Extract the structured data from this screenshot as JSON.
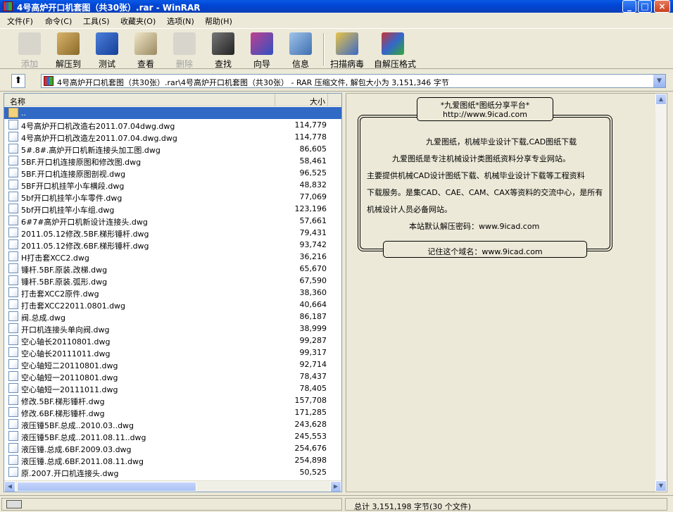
{
  "window": {
    "title": "4号高炉开口机套图（共30张）.rar - WinRAR",
    "min": "_",
    "max": "□",
    "close": "×"
  },
  "menu": [
    "文件(F)",
    "命令(C)",
    "工具(S)",
    "收藏夹(O)",
    "选项(N)",
    "帮助(H)"
  ],
  "toolbar": [
    {
      "label": "添加",
      "icon": "add-icon",
      "disabled": true
    },
    {
      "label": "解压到",
      "icon": "extract-icon",
      "disabled": false
    },
    {
      "label": "测试",
      "icon": "test-icon",
      "disabled": false
    },
    {
      "label": "查看",
      "icon": "view-icon",
      "disabled": false
    },
    {
      "label": "删除",
      "icon": "delete-icon",
      "disabled": true
    },
    {
      "label": "查找",
      "icon": "find-icon",
      "disabled": false
    },
    {
      "label": "向导",
      "icon": "wizard-icon",
      "disabled": false
    },
    {
      "label": "信息",
      "icon": "info-icon",
      "disabled": false
    },
    {
      "label": "扫描病毒",
      "icon": "virus-scan-icon",
      "disabled": false
    },
    {
      "label": "自解压格式",
      "icon": "sfx-icon",
      "disabled": false
    }
  ],
  "address": "4号高炉开口机套图（共30张）.rar\\4号高炉开口机套图（共30张） - RAR 压缩文件, 解包大小为 3,151,346 字节",
  "columns": {
    "name": "名称",
    "size": "大小"
  },
  "files": [
    {
      "name": "..",
      "size": "",
      "folder": true
    },
    {
      "name": "4号高炉开口机改造右2011.07.04dwg.dwg",
      "size": "114,779"
    },
    {
      "name": "4号高炉开口机改造左2011.07.04.dwg.dwg",
      "size": "114,778"
    },
    {
      "name": "5#.8#.高炉开口机新连接头加工图.dwg",
      "size": "86,605"
    },
    {
      "name": "5BF.开口机连接原图和修改图.dwg",
      "size": "58,461"
    },
    {
      "name": "5BF.开口机连接原图剖视.dwg",
      "size": "96,525"
    },
    {
      "name": "5BF开口机挂竿小车横段.dwg",
      "size": "48,832"
    },
    {
      "name": "5bf开口机挂竿小车零件.dwg",
      "size": "77,069"
    },
    {
      "name": "5bf开口机挂竿小车组.dwg",
      "size": "123,196"
    },
    {
      "name": "6#7#高炉开口机新设计连接头.dwg",
      "size": "57,661"
    },
    {
      "name": "2011.05.12修改.5BF.梯形锤杆.dwg",
      "size": "79,431"
    },
    {
      "name": "2011.05.12修改.6BF.梯形锤杆.dwg",
      "size": "93,742"
    },
    {
      "name": "H打击套XCC2.dwg",
      "size": "36,216"
    },
    {
      "name": "锤杆.5BF.原装.改梯.dwg",
      "size": "65,670"
    },
    {
      "name": "锤杆.5BF.原装.弧形.dwg",
      "size": "67,590"
    },
    {
      "name": "打击套XCC2原件.dwg",
      "size": "38,360"
    },
    {
      "name": "打击套XCC22011.0801.dwg",
      "size": "40,664"
    },
    {
      "name": "阀.总成.dwg",
      "size": "86,187"
    },
    {
      "name": "开口机连接头单向阀.dwg",
      "size": "38,999"
    },
    {
      "name": "空心轴长20110801.dwg",
      "size": "99,287"
    },
    {
      "name": "空心轴长20111011.dwg",
      "size": "99,317"
    },
    {
      "name": "空心轴短二20110801.dwg",
      "size": "92,714"
    },
    {
      "name": "空心轴短一20110801.dwg",
      "size": "78,437"
    },
    {
      "name": "空心轴短一20111011.dwg",
      "size": "78,405"
    },
    {
      "name": "修改.5BF.梯形锤杆.dwg",
      "size": "157,708"
    },
    {
      "name": "修改.6BF.梯形锤杆.dwg",
      "size": "171,285"
    },
    {
      "name": "液压锤5BF.总成..2010.03..dwg",
      "size": "243,628"
    },
    {
      "name": "液压锤5BF.总成..2011.08.11..dwg",
      "size": "245,553"
    },
    {
      "name": "液压锤.总成.6BF.2009.03.dwg",
      "size": "254,676"
    },
    {
      "name": "液压锤.总成.6BF.2011.08.11.dwg",
      "size": "254,898"
    },
    {
      "name": "原.2007.开口机连接头.dwg",
      "size": "50,525"
    }
  ],
  "comment": {
    "header1": "*九爱图纸*图纸分享平台*",
    "header2": "http://www.9icad.com",
    "lines": [
      "九爱图纸，机械毕业设计下载,CAD图纸下载",
      "九爱图纸是专注机械设计类图纸资料分享专业网站。",
      "主要提供机械CAD设计图纸下载、机械毕业设计下载等工程资料",
      "下载服务。是集CAD、CAE、CAM、CAX等资料的交流中心，是所有",
      "机械设计人员必备网站。",
      "本站默认解压密码：www.9icad.com"
    ],
    "footer": "记住这个域名：www.9icad.com"
  },
  "status": {
    "total": "总计 3,151,198 字节(30 个文件)"
  }
}
